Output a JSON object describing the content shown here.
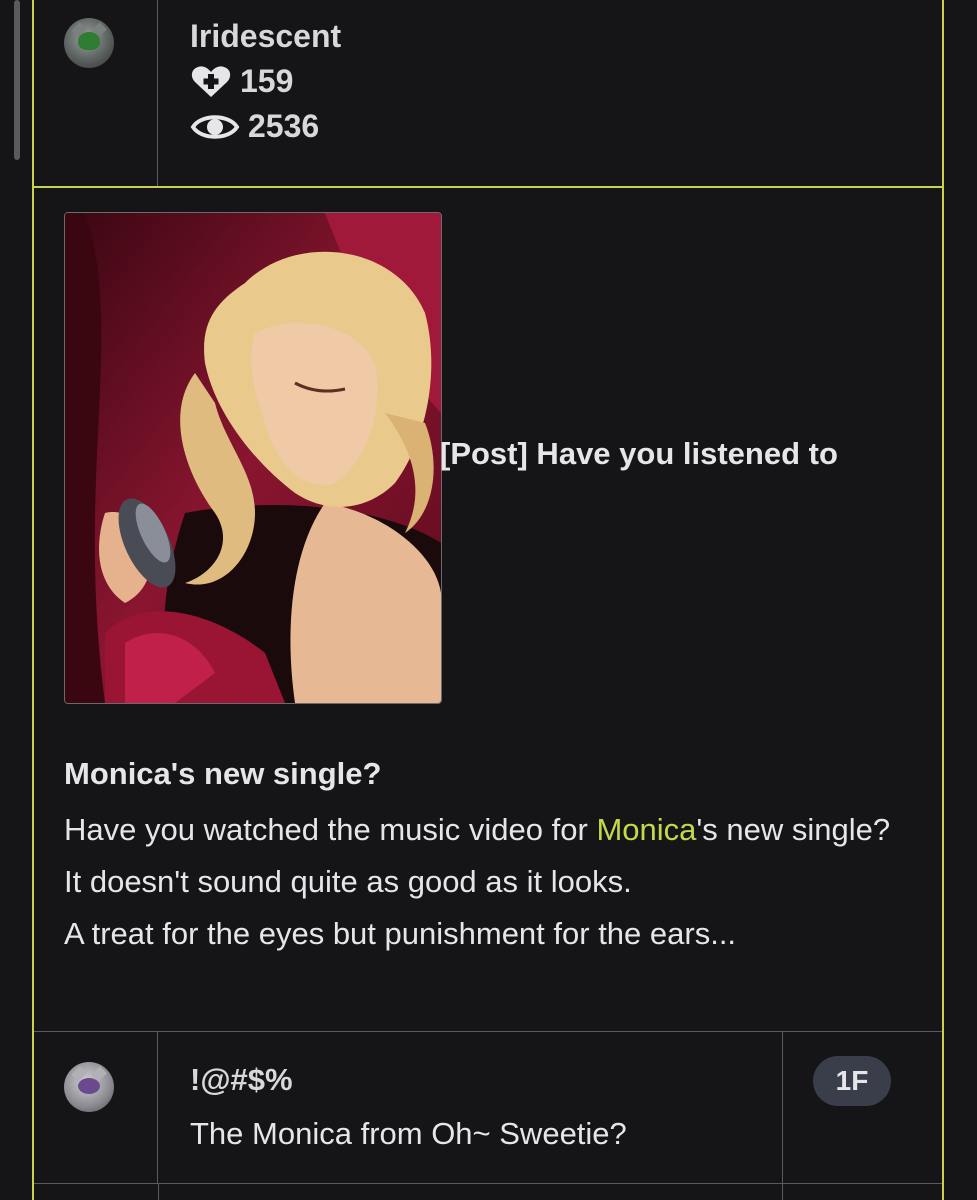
{
  "post_author": {
    "name": "Iridescent",
    "likes": "159",
    "views": "2536"
  },
  "post": {
    "title_part1": "[Post] Have you listened to",
    "title_part2": "Monica's new single?",
    "body_line1_a": "Have you watched the music video for ",
    "body_line1_highlight": "Monica",
    "body_line1_b": "'s new single?",
    "body_line2": "It doesn't sound quite as good as it looks.",
    "body_line3": "A treat for the eyes but punishment for the ears...",
    "highlight_color": "#c5d84a"
  },
  "reply": {
    "user": "!@#$%",
    "text": "The Monica from Oh~ Sweetie?",
    "floor": "1F"
  },
  "theme": {
    "background": "#151517",
    "border_accent": "#c8d24a",
    "divider": "#5a5a63"
  },
  "icons": {
    "likes": "heart-plus-icon",
    "views": "eye-icon"
  }
}
